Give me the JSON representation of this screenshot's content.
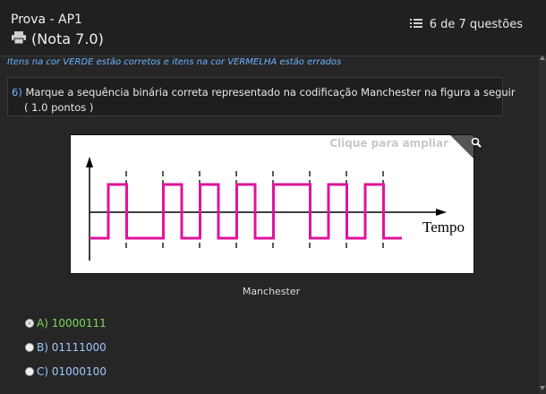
{
  "header": {
    "exam_title": "Prova - AP1",
    "grade": "(Nota 7.0)",
    "progress": "6 de 7 questões",
    "print_icon": "printer-icon",
    "list_icon": "list-icon"
  },
  "legend": "Itens na cor VERDE estão corretos e itens na cor VERMELHA estão errados",
  "question": {
    "number": "6)",
    "text": "Marque a sequência binária correta representado na codificação Manchester na figura a seguir",
    "points": "( 1.0 pontos )"
  },
  "figure": {
    "zoom_hint": "Clique para ampliar",
    "zoom_icon": "magnifier-icon",
    "axis_label": "Tempo",
    "caption": "Manchester",
    "chart_data": {
      "type": "line",
      "bits": [
        1,
        0,
        0,
        0,
        0,
        1,
        1,
        1
      ],
      "signal_color": "#e0139a"
    }
  },
  "options": [
    {
      "label": "A) 10000111",
      "color": "#7ed957",
      "selected": true
    },
    {
      "label": "B) 01111000",
      "color": "#9fc8ff",
      "selected": false
    },
    {
      "label": "C) 01000100",
      "color": "#9fc8ff",
      "selected": false
    }
  ],
  "colors": {
    "background": "#262626",
    "accent": "#6cb4ff",
    "correct": "#7ed957"
  }
}
